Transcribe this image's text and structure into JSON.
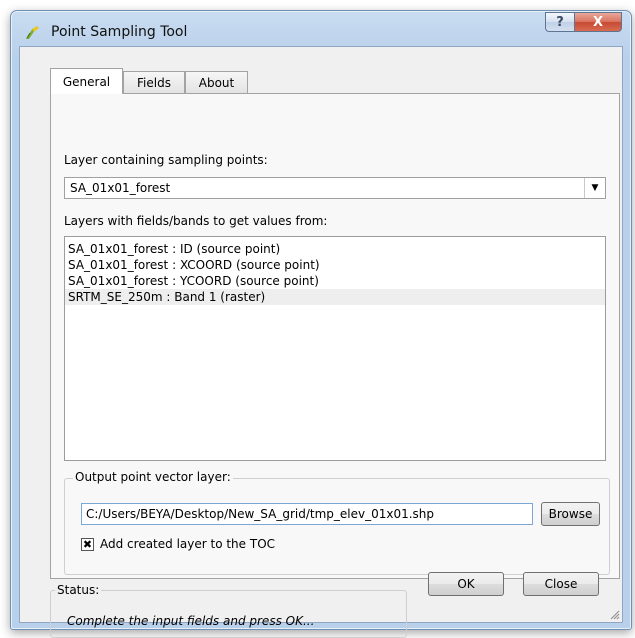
{
  "window": {
    "title": "Point Sampling Tool",
    "help_glyph": "?",
    "close_glyph": "X"
  },
  "tabs": [
    {
      "label": "General"
    },
    {
      "label": "Fields"
    },
    {
      "label": "About"
    }
  ],
  "general": {
    "layer_label": "Layer containing sampling points:",
    "layer_value": "SA_01x01_forest",
    "fields_label": "Layers with fields/bands to get values from:",
    "fields_items": [
      {
        "label": "SA_01x01_forest : ID (source point)"
      },
      {
        "label": "SA_01x01_forest : XCOORD (source point)"
      },
      {
        "label": "SA_01x01_forest : YCOORD (source point)"
      },
      {
        "label": "SRTM_SE_250m : Band 1 (raster)"
      }
    ],
    "output_group_title": "Output point vector layer:",
    "output_path": "C:/Users/BEYA/Desktop/New_SA_grid/tmp_elev_01x01.shp",
    "browse_label": "Browse",
    "add_to_toc_label": "Add created layer to the TOC",
    "add_to_toc_checked": true
  },
  "status": {
    "title": "Status:",
    "message": "Complete the input fields and press OK..."
  },
  "buttons": {
    "ok": "OK",
    "close": "Close"
  },
  "colors": {
    "title_bar": "#c3d8ef",
    "close_button": "#c9472f",
    "dialog_bg": "#f0f0f0",
    "icon_green": "#7cae2f",
    "icon_yellow": "#e5c728"
  },
  "icons": {
    "app": "qgis-plugin-icon",
    "dropdown": "chevron-down-icon",
    "check": "check-mark-icon"
  }
}
